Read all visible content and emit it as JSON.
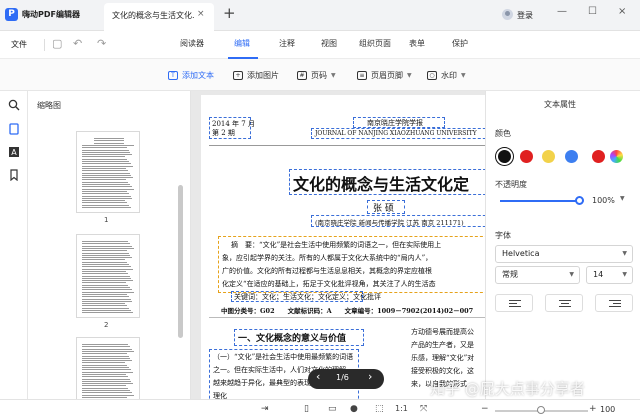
{
  "app": {
    "name": "嗨动PDF编辑器"
  },
  "document_tab": {
    "title": "文化的概念与生活文化...",
    "close": "×",
    "new": "+"
  },
  "account": {
    "login": "登录"
  },
  "window_controls": {
    "minimize": "—",
    "maximize": "☐",
    "close": "×"
  },
  "menu": {
    "file": "文件",
    "tabs": [
      "阅读器",
      "编辑",
      "注释",
      "视图",
      "组织页面",
      "表单",
      "保护"
    ],
    "active_tab": "编辑"
  },
  "toolbar": {
    "add_text": "添加文本",
    "add_image": "添加图片",
    "page_number": "页码",
    "header_footer": "页眉页脚",
    "watermark": "水印"
  },
  "thumbnail_panel": {
    "title": "缩略图",
    "pages": [
      "1",
      "2"
    ]
  },
  "page_nav": {
    "prev": "‹",
    "indicator": "1/6",
    "next": "›"
  },
  "document": {
    "issue_line1": "2014 年 7 月",
    "issue_line2": "第 2 期",
    "journal_cn": "南京晓庄学院学报",
    "journal_en": "JOURNAL OF NANJING XIAOZHUANG UNIVERSITY",
    "title": "文化的概念与生活文化定",
    "author": "张 硕",
    "affiliation": "(南京晓庄学院 新闻与传播学院 江苏 南京 211171)",
    "abstract_lines": [
      "摘　要：“文化”是社会生活中使用频繁的词语之一，但在实际使用上",
      "象，应引起学界的关注。所有的人都属于文化大系统中的“局内人”，",
      "广的价值。文化的所有过程都与生活息息相关，其概念的界定应植根",
      "化定义“在适应的基础上，拓足于文化批评视角，其关注了人的生活态"
    ],
    "keywords": "关键词：文化；生活文化；文化定义；文化批评",
    "classification": "中图分类号：G02　　文献标识码：A　　文章编号：1009－7902(2014)02－007",
    "section_heading": "一、文化概念的意义与价值",
    "body_left": [
      "（一）“文化”是社会生活中使用最频繁的词语",
      "之一。但在实际生活中，人们对文化的理解",
      "越来越趋于异化，最典型的表现",
      "理化"
    ],
    "body_right": [
      "方动德号展而提高公",
      "产品的生产者，又是",
      "乐感，理解“文化”对",
      "接受积极的文化，这",
      "来，以自我的形式"
    ]
  },
  "text_properties": {
    "title": "文本属性",
    "color_label": "颜色",
    "colors": [
      "#111111",
      "#e02020",
      "#f2d24a",
      "#3d7ff0",
      "#e02020"
    ],
    "opacity_label": "不透明度",
    "opacity": "100%",
    "opacity_value": 1.0,
    "font_label": "字体",
    "font": "Helvetica",
    "style": "常规",
    "size": "14"
  },
  "status": {
    "zoom": "100"
  },
  "watermark_text": "知乎 @屁大点事分享者"
}
